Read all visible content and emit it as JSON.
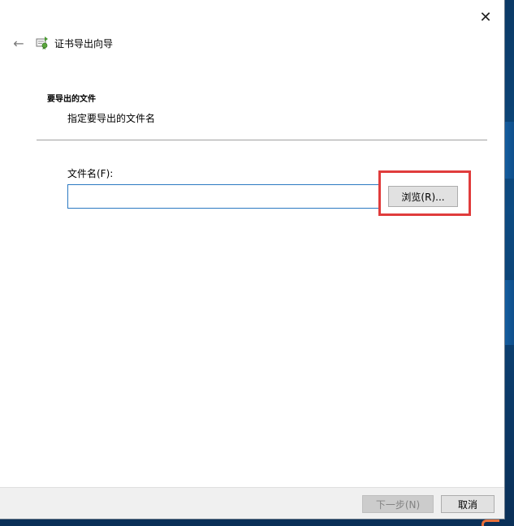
{
  "window": {
    "title": "证书导出向导",
    "close_glyph": "✕",
    "back_glyph": "←"
  },
  "page": {
    "heading": "要导出的文件",
    "subheading": "指定要导出的文件名"
  },
  "form": {
    "filename_label": "文件名(F):",
    "filename_value": "",
    "browse_label": "浏览(R)..."
  },
  "footer": {
    "next_label": "下一步(N)",
    "cancel_label": "取消"
  },
  "icons": {
    "back": "back-arrow-icon",
    "wizard": "certificate-wizard-icon",
    "close": "close-icon"
  },
  "colors": {
    "accent_input_border": "#2b79c2",
    "highlight": "#e03c3c",
    "button_bg": "#e1e1e1",
    "footer_bg": "#f0f0f0"
  }
}
